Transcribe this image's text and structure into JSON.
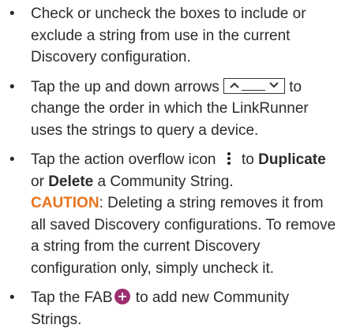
{
  "items": [
    {
      "text": "Check or uncheck the boxes to include or exclude a string from use in the current Discovery configuration."
    },
    {
      "before": "Tap the up and down arrows",
      "after": "to change the order in which the LinkRunner uses the strings to query a device."
    },
    {
      "before": "Tap the action overflow icon",
      "to": "to",
      "duplicate": "Duplicate",
      "or": "or",
      "delete": "Delete",
      "end": "a Community String.",
      "caution_label": "CAUTION",
      "caution_text": ": Deleting a string removes it from all saved Discovery configurations. To remove a string from the current Discovery configuration only, simply uncheck it."
    },
    {
      "before": "Tap the FAB",
      "after": "to add new Community Strings."
    }
  ],
  "bullet": "•",
  "colors": {
    "text": "#2b2b2b",
    "caution": "#e8731c",
    "fab": "#9c2e6f"
  },
  "icons": [
    "up-down-arrows-icon",
    "action-overflow-icon",
    "fab-add-icon"
  ]
}
